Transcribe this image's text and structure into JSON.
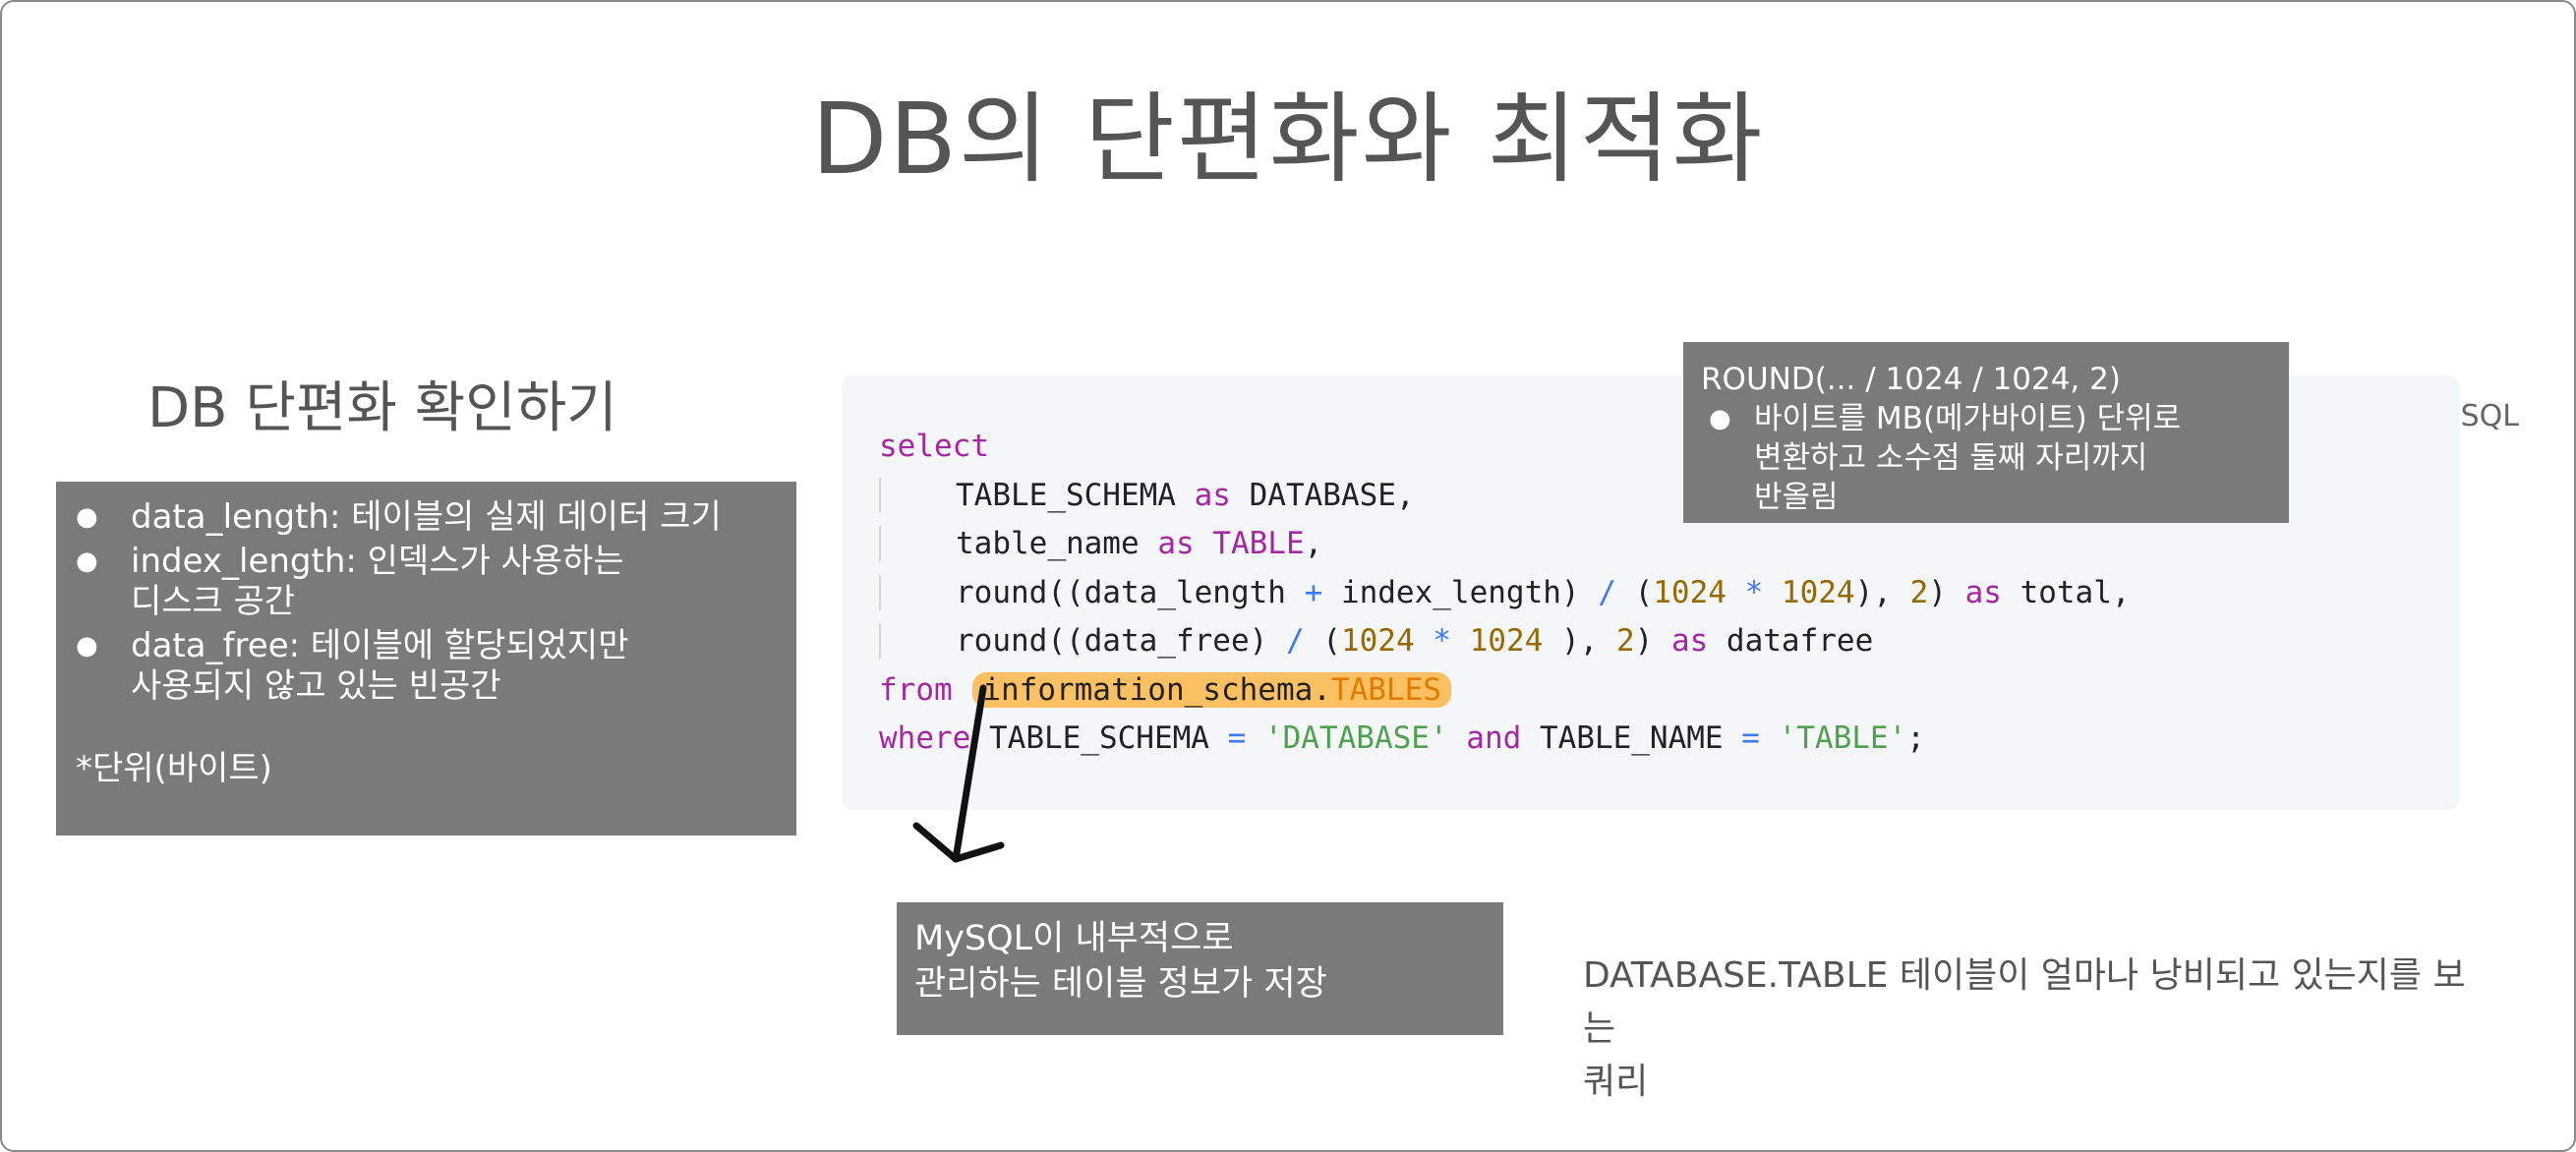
{
  "slide_title": "DB의 단편화와 최적화",
  "section_title": "DB 단편화 확인하기",
  "left_box": {
    "items": [
      [
        "data_length: 테이블의 실제 데이터 크기"
      ],
      [
        "index_length: 인덱스가 사용하는",
        "디스크 공간"
      ],
      [
        "data_free: 테이블에 할당되었지만",
        "사용되지 않고 있는 빈공간"
      ]
    ],
    "unit_note": "*단위(바이트)"
  },
  "code": {
    "language": "SQL",
    "lines": [
      {
        "indent": false,
        "tokens": [
          [
            "kw",
            "select"
          ]
        ]
      },
      {
        "indent": true,
        "tokens": [
          [
            "",
            "TABLE_SCHEMA "
          ],
          [
            "kw",
            "as"
          ],
          [
            "",
            " DATABASE,"
          ]
        ]
      },
      {
        "indent": true,
        "tokens": [
          [
            "",
            "table_name "
          ],
          [
            "kw",
            "as"
          ],
          [
            "",
            " "
          ],
          [
            "kw",
            "TABLE"
          ],
          [
            "",
            ","
          ]
        ]
      },
      {
        "indent": true,
        "tokens": [
          [
            "",
            "round((data_length "
          ],
          [
            "op",
            "+"
          ],
          [
            "",
            " index_length) "
          ],
          [
            "op",
            "/"
          ],
          [
            "",
            " ("
          ],
          [
            "num",
            "1024"
          ],
          [
            "",
            " "
          ],
          [
            "op",
            "*"
          ],
          [
            "",
            " "
          ],
          [
            "num",
            "1024"
          ],
          [
            "",
            "), "
          ],
          [
            "num",
            "2"
          ],
          [
            "",
            ") "
          ],
          [
            "kw",
            "as"
          ],
          [
            "",
            " total,"
          ]
        ]
      },
      {
        "indent": true,
        "tokens": [
          [
            "",
            "round((data_free) "
          ],
          [
            "op",
            "/"
          ],
          [
            "",
            " ("
          ],
          [
            "num",
            "1024"
          ],
          [
            "",
            " "
          ],
          [
            "op",
            "*"
          ],
          [
            "",
            " "
          ],
          [
            "num",
            "1024"
          ],
          [
            "",
            " ), "
          ],
          [
            "num",
            "2"
          ],
          [
            "",
            ") "
          ],
          [
            "kw",
            "as"
          ],
          [
            "",
            " datafree"
          ]
        ]
      },
      {
        "indent": false,
        "tokens": [
          [
            "kw",
            "from"
          ],
          [
            "",
            " "
          ],
          [
            "hl",
            "information_schema.|TABLES"
          ]
        ]
      },
      {
        "indent": false,
        "tokens": [
          [
            "kw",
            "where"
          ],
          [
            "",
            " TABLE_SCHEMA "
          ],
          [
            "op",
            "="
          ],
          [
            "",
            " "
          ],
          [
            "str",
            "'DATABASE'"
          ],
          [
            "",
            " "
          ],
          [
            "kw",
            "and"
          ],
          [
            "",
            " TABLE_NAME "
          ],
          [
            "op",
            "="
          ],
          [
            "",
            " "
          ],
          [
            "str",
            "'TABLE'"
          ],
          [
            "",
            ";"
          ]
        ]
      }
    ]
  },
  "top_callout": {
    "head": "ROUND(... / 1024 / 1024, 2)",
    "bullet_lines": [
      "바이트를 MB(메가바이트) 단위로",
      "변환하고 소수점 둘째 자리까지",
      "반올림"
    ]
  },
  "bottom_callout": {
    "lines": [
      "MySQL이 내부적으로",
      "관리하는 테이블 정보가 저장"
    ]
  },
  "note": {
    "lines": [
      "DATABASE.TABLE 테이블이 얼마나 낭비되고 있는지를 보는",
      "쿼리"
    ]
  },
  "colors": {
    "title": "#555555",
    "gray_box": "#7a7a7a",
    "code_bg": "#f5f6f8",
    "highlight": "#fbc061",
    "keyword": "#a626a4",
    "number": "#986801",
    "operator": "#4078f2",
    "string": "#50a14f"
  }
}
